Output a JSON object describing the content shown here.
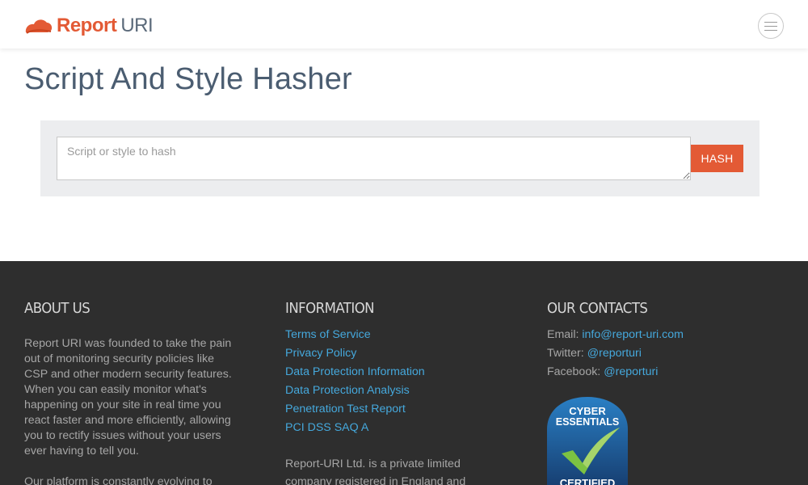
{
  "header": {
    "logo_report": "Report",
    "logo_uri": "URI",
    "menu_icon": "hamburger-menu-icon"
  },
  "page": {
    "title": "Script And Style Hasher"
  },
  "hasher": {
    "input_placeholder": "Script or style to hash",
    "input_value": "",
    "button_label": "HASH"
  },
  "footer": {
    "about": {
      "heading": "ABOUT US",
      "paragraphs": [
        "Report URI was founded to take the pain out of monitoring security policies like CSP and other modern security features. When you can easily monitor what's happening on your site in real time you react faster and more efficiently, allowing you to rectify issues without your users ever having to tell you.",
        "Our platform is constantly evolving to"
      ]
    },
    "information": {
      "heading": "INFORMATION",
      "links": [
        "Terms of Service",
        "Privacy Policy",
        "Data Protection Information",
        "Data Protection Analysis",
        "Penetration Test Report",
        "PCI DSS SAQ A"
      ],
      "company_text": "Report-URI Ltd. is a private limited company registered in England and"
    },
    "contacts": {
      "heading": "OUR CONTACTS",
      "email_label": "Email:",
      "email_value": "info@report-uri.com",
      "twitter_label": "Twitter:",
      "twitter_value": "@reporturi",
      "facebook_label": "Facebook:",
      "facebook_value": "@reporturi",
      "badge_line1": "CYBER",
      "badge_line2": "ESSENTIALS",
      "badge_line3": "CERTIFIED"
    }
  },
  "colors": {
    "brand_orange": "#e35a35",
    "brand_slate": "#5b6a7a",
    "link_blue": "#45a8dc",
    "footer_bg": "#2e2e2e"
  }
}
